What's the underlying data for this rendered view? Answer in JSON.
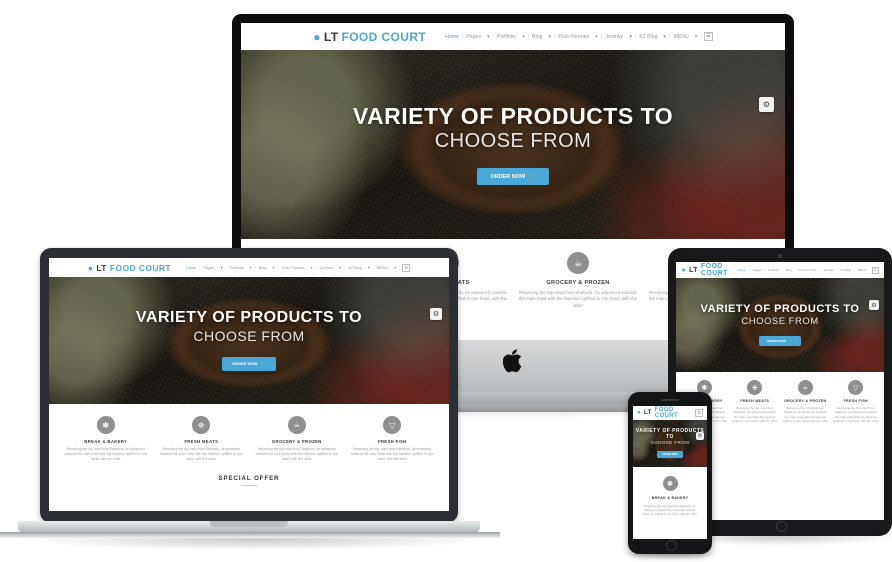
{
  "site": {
    "logo": {
      "pin_icon": "map-pin-icon",
      "lt": "LT",
      "name": "FOOD COURT"
    },
    "nav": {
      "items": [
        "Home",
        "Pages",
        "Portfolio",
        "Blog",
        "Post Formats",
        "Joomla!",
        "K2 Blog",
        "MENU"
      ],
      "caret": "▾",
      "separator": "|",
      "burger_icon": "☰"
    },
    "hero": {
      "title_line1": "VARIETY OF PRODUCTS TO",
      "title_line2": "CHOOSE FROM",
      "cta_label": "ORDER NOW",
      "cta_icon": "cart-icon",
      "settings_icon": "gear-icon"
    },
    "features": [
      {
        "icon": "bread-icon",
        "glyph": "✽",
        "title": "BREAK & BAKERY",
        "body": "Receiving the top-maul from Starbuck, he advanced towards the main mast with the hammer uplifted in one hand, with the other"
      },
      {
        "icon": "meat-icon",
        "glyph": "❉",
        "title": "FRESH MEATS",
        "body": "Receiving the top-maul from Starbuck, he advanced towards the main mast with the hammer uplifted in one hand, with the other"
      },
      {
        "icon": "grocery-basket-icon",
        "glyph": "☕",
        "title": "GROCERY & PROZEN",
        "body": "Receiving the top-maul from Starbuck, he advanced towards the main mast with the hammer uplifted in one hand, with the other"
      },
      {
        "icon": "fish-icon",
        "glyph": "▽",
        "title": "FRESH FISH",
        "body": "Receiving the top-maul from Starbuck, he advanced towards the main mast with the hammer uplifted in one hand, with the other"
      }
    ],
    "special_offer": "SPECIAL OFFER"
  },
  "devices": {
    "desktop": {
      "name": "imac",
      "apple_logo": "apple-logo-icon"
    },
    "laptop": {
      "name": "macbook"
    },
    "tablet": {
      "name": "ipad"
    },
    "phone": {
      "name": "iphone"
    }
  },
  "colors": {
    "accent": "#4aa8d8",
    "logo_dark": "#3a3a3a",
    "nav_text": "#9a9a9a",
    "feature_title": "#3c3c3c",
    "feature_body": "#9d9d9d",
    "icon_circle": "#8f8f8f",
    "page_bg": "#ffffff"
  }
}
